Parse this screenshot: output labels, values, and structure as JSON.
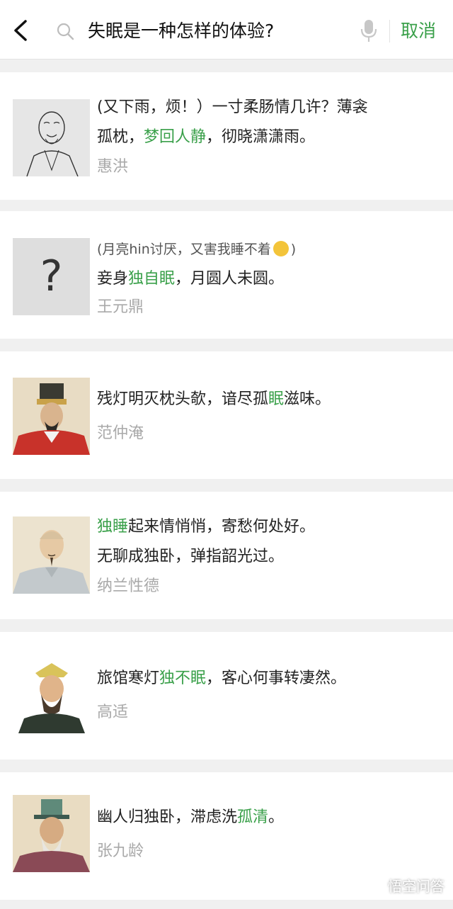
{
  "search": {
    "query": "失眠是一种怎样的体验?",
    "cancel_label": "取消"
  },
  "results": [
    {
      "segments1": [
        "(又下雨，烦！）一寸柔肠情几许？薄衾"
      ],
      "line2_pre": "孤枕，",
      "line2_hl": "梦回人静",
      "line2_post": "，彻晓潇潇雨。",
      "author": "惠洪"
    },
    {
      "note_pre": "(月亮hin讨厌，又害我睡不着",
      "note_post": ")",
      "line_pre": "妾身",
      "line_hl": "独自眠",
      "line_post": "，月圆人未圆。",
      "author": "王元鼎",
      "portrait_text": "?"
    },
    {
      "line_pre": "残灯明灭枕头欹，谙尽孤",
      "line_hl": "眠",
      "line_post": "滋味。",
      "author": "范仲淹"
    },
    {
      "line1_hl": "独睡",
      "line1_post": "起来情悄悄，寄愁何处好。",
      "line2": "无聊成独卧，弹指韶光过。",
      "author": "纳兰性德"
    },
    {
      "line_pre": "旅馆寒灯",
      "line_hl": "独不眠",
      "line_post": "，客心何事转凄然。",
      "author": "高适"
    },
    {
      "line_pre": "幽人归独卧，滞虑洗",
      "line_hl": "孤清",
      "line_post": "。",
      "author": "张九龄"
    }
  ],
  "watermark": "悟空问答",
  "colors": {
    "highlight": "#3aa04a",
    "author": "#a9a9a9",
    "background": "#f0f0f0"
  }
}
